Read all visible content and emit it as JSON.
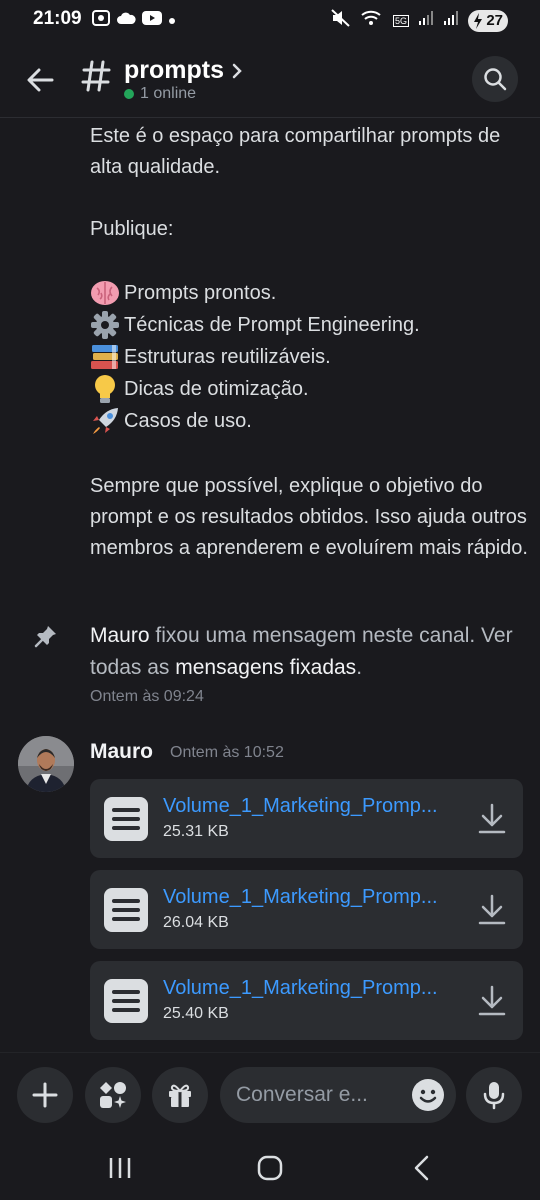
{
  "status_bar": {
    "time": "21:09",
    "network": "5G",
    "battery": "27"
  },
  "header": {
    "channel_name": "prompts",
    "online_text": "1 online"
  },
  "message": {
    "intro": "Este é o espaço para compartilhar prompts de alta qualidade.",
    "publish_label": "Publique:",
    "items": [
      {
        "emoji": "brain-emoji",
        "text": "Prompts prontos."
      },
      {
        "emoji": "gear-emoji",
        "text": "Técnicas de Prompt Engineering."
      },
      {
        "emoji": "books-emoji",
        "text": "Estruturas reutilizáveis."
      },
      {
        "emoji": "bulb-emoji",
        "text": "Dicas de otimização."
      },
      {
        "emoji": "rocket-emoji",
        "text": "Casos de uso."
      }
    ],
    "closing": "Sempre que possível, explique o objetivo do prompt e os resultados obtidos. Isso ajuda outros membros a aprenderem e evoluírem mais rápido."
  },
  "pin_notice": {
    "author": "Mauro",
    "action": " fixou uma mensagem neste canal. Ver todas as ",
    "link": "mensagens fixadas",
    "end": ".",
    "time": "Ontem às 09:24"
  },
  "post": {
    "author": "Mauro",
    "time": "Ontem às 10:52",
    "files": [
      {
        "name": "Volume_1_Marketing_Promp...",
        "size": "25.31 KB"
      },
      {
        "name": "Volume_1_Marketing_Promp...",
        "size": "26.04 KB"
      },
      {
        "name": "Volume_1_Marketing_Promp...",
        "size": "25.40 KB"
      }
    ]
  },
  "composer": {
    "placeholder": "Conversar e..."
  }
}
